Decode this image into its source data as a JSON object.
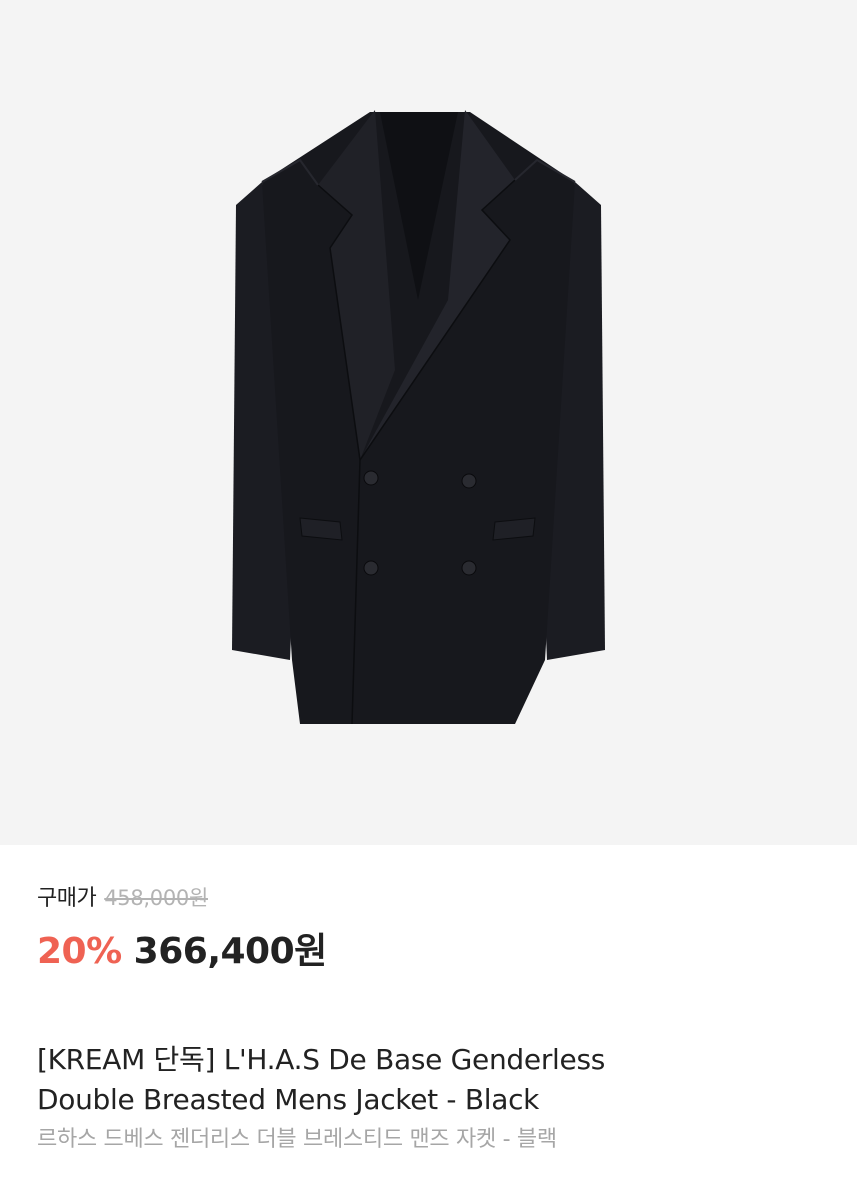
{
  "product": {
    "image_alt": "Black double-breasted jacket",
    "price_label": "구매가",
    "original_price": "458,000원",
    "discount_percent": "20%",
    "sale_price": "366,400원",
    "title_line1": "[KREAM 단독] L'H.A.S De Base Genderless",
    "title_line2": "Double Breasted Mens Jacket - Black",
    "subtitle": "르하스 드베스 젠더리스 더블 브레스티드 맨즈 자켓 - 블랙"
  },
  "colors": {
    "image_background": "#f4f4f4",
    "discount": "#ef6253",
    "original_price": "#b3b3b3",
    "subtitle": "#a6a6a6",
    "jacket": "#17181d"
  }
}
